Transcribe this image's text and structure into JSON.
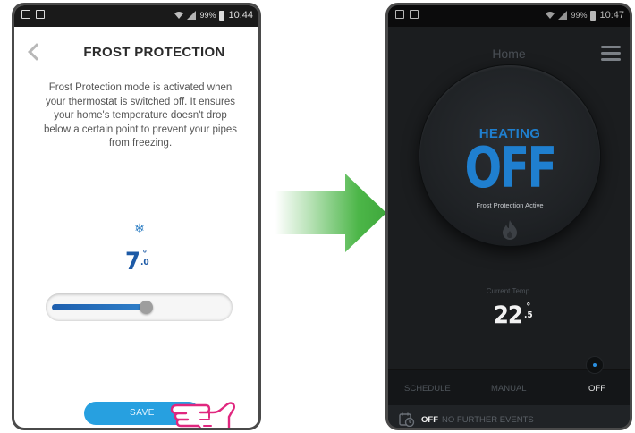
{
  "left_screen": {
    "status_bar": {
      "battery": "99%",
      "time": "10:44"
    },
    "title": "FROST PROTECTION",
    "description": "Frost Protection mode is activated when your thermostat is switched off. It ensures your home's temperature doesn't drop below a certain point to prevent your pipes from freezing.",
    "setpoint": {
      "whole": "7",
      "decimal": ".0",
      "degree": "°",
      "slider_fraction": 0.54
    },
    "save_label": "SAVE"
  },
  "right_screen": {
    "status_bar": {
      "battery": "99%",
      "time": "10:47"
    },
    "title": "Home",
    "dial": {
      "heading": "HEATING",
      "state": "OFF",
      "note": "Frost Protection Active"
    },
    "current_temp": {
      "label": "Current Temp.",
      "whole": "22",
      "decimal": ".5",
      "degree": "°"
    },
    "mode_tabs": [
      {
        "label": "SCHEDULE"
      },
      {
        "label": "MANUAL"
      },
      {
        "label": "OFF"
      }
    ],
    "active_mode": "OFF",
    "events": {
      "state": "OFF",
      "text": "NO FURTHER EVENTS"
    }
  },
  "colors": {
    "accent_blue": "#1f7fcf",
    "save_button": "#27a0e0",
    "arrow_green": "#4cb648",
    "dark_background": "#1b1d1f"
  },
  "icons": {
    "back": "chevron-left-icon",
    "snowflake": "snowflake-icon",
    "menu": "hamburger-menu-icon",
    "flame": "flame-icon",
    "schedule": "schedule-clock-icon",
    "pointer": "hand-pointer-icon"
  }
}
